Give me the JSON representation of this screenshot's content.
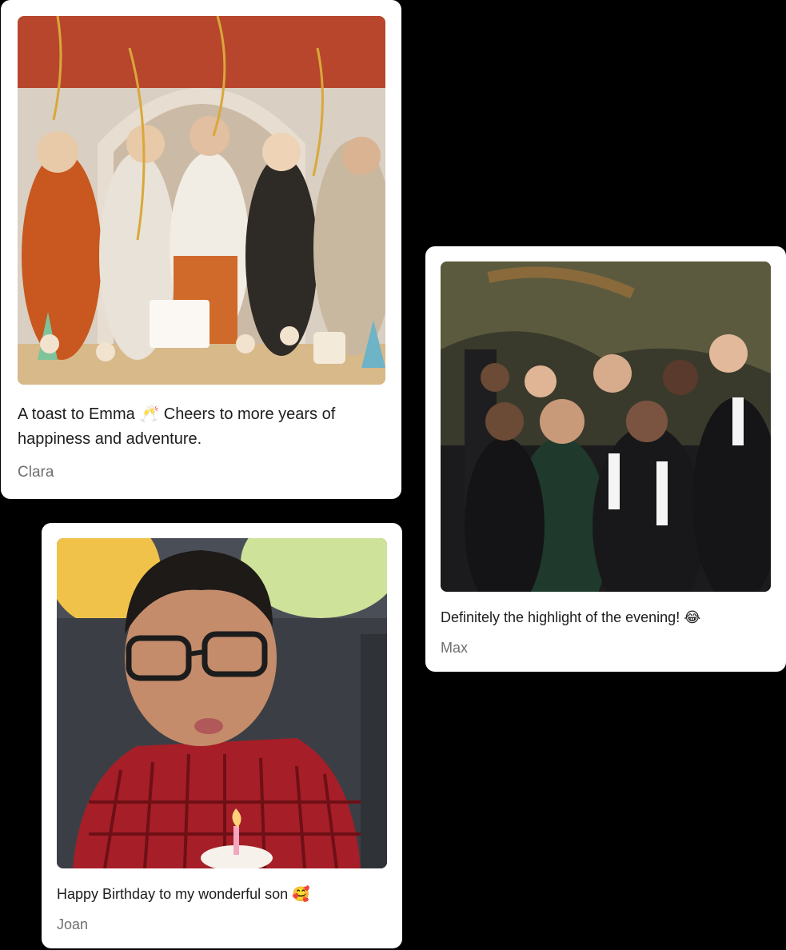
{
  "posts": [
    {
      "caption": "A toast to Emma 🥂 Cheers to more years of happiness and adventure.",
      "author": "Clara"
    },
    {
      "caption": "Definitely the highlight of the evening! 😂",
      "author": "Max"
    },
    {
      "caption": "Happy Birthday to my wonderful son 🥰",
      "author": "Joan"
    }
  ],
  "colors": {
    "background": "#000000",
    "card": "#ffffff",
    "caption_text": "#1d1d1f",
    "author_text": "#6f6f73"
  }
}
